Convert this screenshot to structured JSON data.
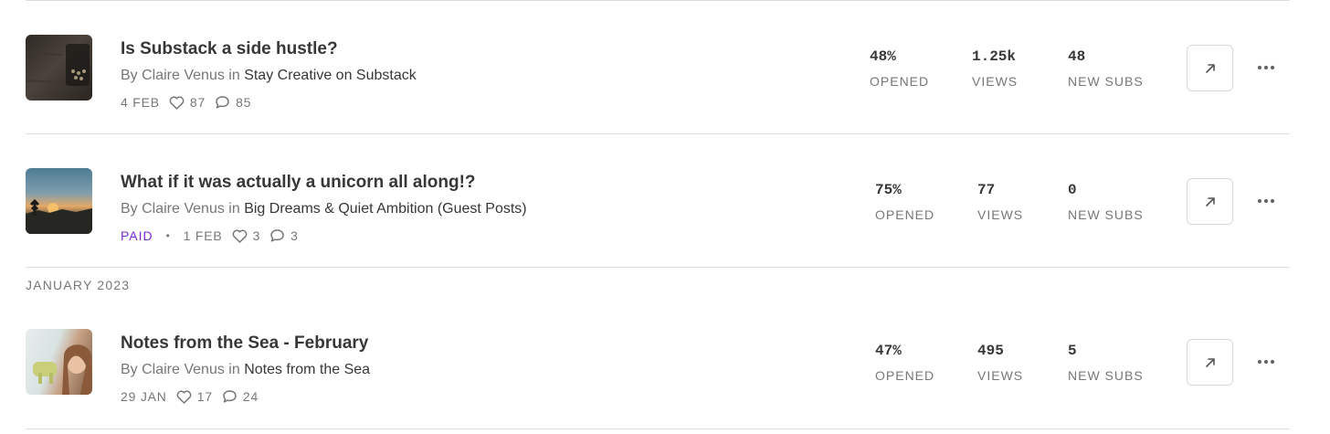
{
  "sections": [
    {
      "heading": "JANUARY 2023"
    }
  ],
  "posts": [
    {
      "title": "Is Substack a side hustle?",
      "by": "By Claire Venus in",
      "publication": "Stay Creative on Substack",
      "paid_label": "",
      "date": "4 FEB",
      "likes": "87",
      "comments": "85",
      "opened": "48%",
      "opened_label": "OPENED",
      "views": "1.25k",
      "views_label": "VIEWS",
      "new_subs": "48",
      "new_subs_label": "NEW SUBS",
      "thumbnail": "typewriter photo"
    },
    {
      "title": "What if it was actually a unicorn all along!?",
      "by": "By Claire Venus in",
      "publication": "Big Dreams & Quiet Ambition (Guest Posts)",
      "paid_label": "PAID",
      "date": "1 FEB",
      "likes": "3",
      "comments": "3",
      "opened": "75%",
      "opened_label": "OPENED",
      "views": "77",
      "views_label": "VIEWS",
      "new_subs": "0",
      "new_subs_label": "NEW SUBS",
      "thumbnail": "sunset landscape photo"
    },
    {
      "title": "Notes from the Sea - February",
      "by": "By Claire Venus in",
      "publication": "Notes from the Sea",
      "paid_label": "",
      "date": "29 JAN",
      "likes": "17",
      "comments": "24",
      "opened": "47%",
      "opened_label": "OPENED",
      "views": "495",
      "views_label": "VIEWS",
      "new_subs": "5",
      "new_subs_label": "NEW SUBS",
      "thumbnail": "portrait photo"
    }
  ],
  "icons": {
    "likes": "heart-icon",
    "comments": "comment-icon",
    "open": "arrow-up-right-icon",
    "more": "ellipsis-icon"
  },
  "colors": {
    "text": "#363737",
    "muted": "#777777",
    "paid": "#7a2bd6",
    "divider": "#dcdcdc"
  }
}
